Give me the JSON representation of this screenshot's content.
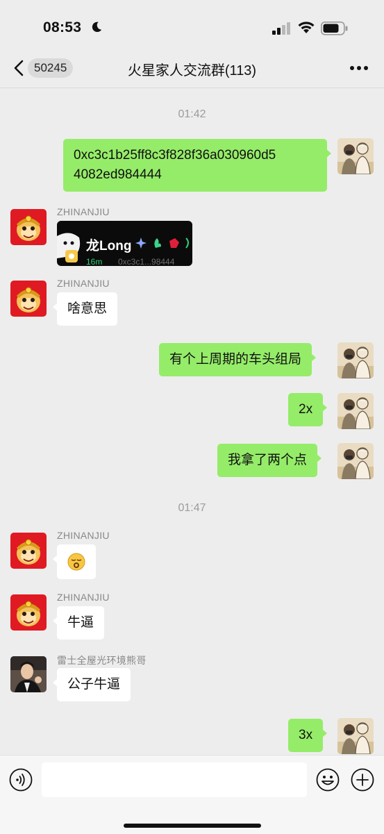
{
  "status_bar": {
    "time": "08:53"
  },
  "nav": {
    "back_count": "50245",
    "title": "火星家人交流群(113)"
  },
  "colors": {
    "background": "#ededed",
    "outgoing_bubble": "#95ec69",
    "incoming_bubble": "#ffffff"
  },
  "messages": {
    "ts1": "01:42",
    "m1_text": "0xc3c1b25ff8c3f828f36a030960d5",
    "m1_text2": "4082ed984444",
    "m2_nick": "ZHINANJIU",
    "m2_card_name": "龙Long",
    "m2_card_time": "16m",
    "m2_card_addr": "0xc3c1...98444",
    "m3_nick": "ZHINANJIU",
    "m3_text": "啥意思",
    "m4_text": "有个上周期的车头组局",
    "m5_text": "2x",
    "m6_text": "我拿了两个点",
    "ts2": "01:47",
    "m7_nick": "ZHINANJIU",
    "m8_nick": "ZHINANJIU",
    "m8_text": "牛逼",
    "m9_nick": "雷士全屋光环境熊哥",
    "m9_text": "公子牛逼",
    "m10_text": "3x"
  },
  "icons": {
    "back": "chevron-left-icon",
    "more": "more-dots-icon",
    "voice": "voice-icon",
    "emoji": "emoji-icon",
    "plus": "plus-icon"
  }
}
